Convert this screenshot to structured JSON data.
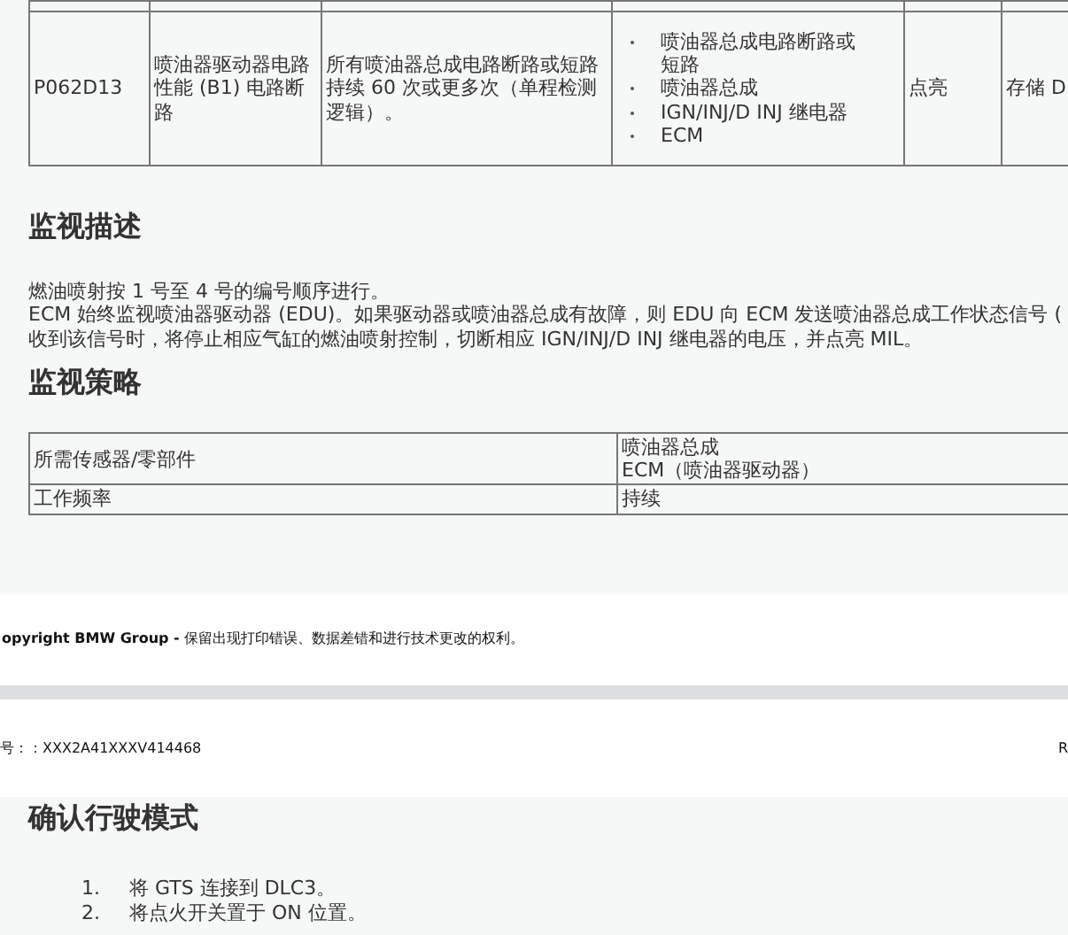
{
  "dtc_table": {
    "rows": [
      {
        "code": "P062D13",
        "description": "喷油器驱动器电路性能 (B1) 电路断路",
        "condition": "所有喷油器总成电路断路或短路持续 60 次或更多次（单程检测逻辑）。",
        "causes": [
          "喷油器总成电路断路或短路",
          "喷油器总成",
          "IGN/INJ/D INJ 继电器",
          "ECM"
        ],
        "mil": "点亮",
        "memory": "存储 D"
      }
    ]
  },
  "monitor_description": {
    "heading": "监视描述",
    "lines": [
      "燃油喷射按 1 号至 4 号的编号顺序进行。",
      "ECM 始终监视喷油器驱动器 (EDU)。如果驱动器或喷油器总成有故障，则 EDU 向 ECM 发送喷油器总成工作状态信号 (",
      "收到该信号时，将停止相应气缸的燃油喷射控制，切断相应 IGN/INJ/D INJ 继电器的电压，并点亮 MIL。"
    ]
  },
  "monitor_strategy": {
    "heading": "监视策略",
    "rows": [
      {
        "label": "所需传感器/零部件",
        "values": [
          "喷油器总成",
          "ECM（喷油器驱动器）"
        ]
      },
      {
        "label": "工作频率",
        "values": [
          "持续"
        ]
      }
    ]
  },
  "footer": {
    "copyright": "opyright BMW Group - ",
    "notice": "保留出现打印错误、数据差错和进行技术更改的权利。"
  },
  "page_header": {
    "document_number": "号：：XXX2A41XXXV414468",
    "right_text": "R"
  },
  "confirm_driving_pattern": {
    "heading": "确认行驶模式",
    "steps": [
      {
        "number": "1.",
        "text": "将 GTS 连接到 DLC3。"
      },
      {
        "number": "2.",
        "text": "将点火开关置于 ON 位置。"
      }
    ]
  }
}
